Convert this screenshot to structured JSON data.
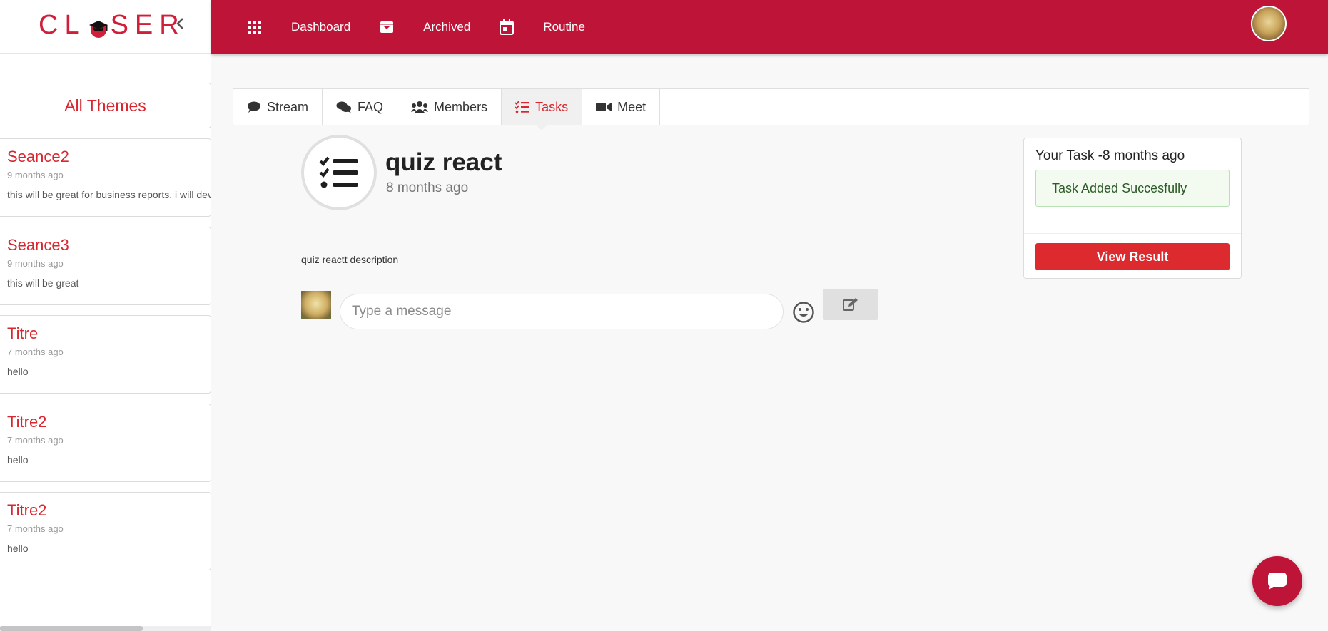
{
  "sidebar": {
    "logo_left": "CL",
    "logo_right": "SER",
    "header": "All Themes",
    "themes": [
      {
        "title": "Seance2",
        "time": "9 months ago",
        "desc": "this will be great for business reports. i will develop"
      },
      {
        "title": "Seance3",
        "time": "9 months ago",
        "desc": "this will be great"
      },
      {
        "title": "Titre",
        "time": "7 months ago",
        "desc": "hello"
      },
      {
        "title": "Titre2",
        "time": "7 months ago",
        "desc": "hello"
      },
      {
        "title": "Titre2",
        "time": "7 months ago",
        "desc": "hello"
      }
    ]
  },
  "topnav": {
    "dashboard": "Dashboard",
    "archived": "Archived",
    "routine": "Routine"
  },
  "tabs": [
    "Stream",
    "FAQ",
    "Members",
    "Tasks",
    "Meet"
  ],
  "active_tab": "Tasks",
  "task": {
    "title": "quiz react",
    "time": "8 months ago",
    "description": "quiz reactt description"
  },
  "comment": {
    "placeholder": "Type a message"
  },
  "your_task": {
    "title": "Your Task -8 months ago",
    "alert": "Task Added Succesfully",
    "button": "View Result"
  },
  "colors": {
    "brand": "#be1437",
    "accent_red": "#d9262f",
    "success_text": "#2d5b27"
  }
}
